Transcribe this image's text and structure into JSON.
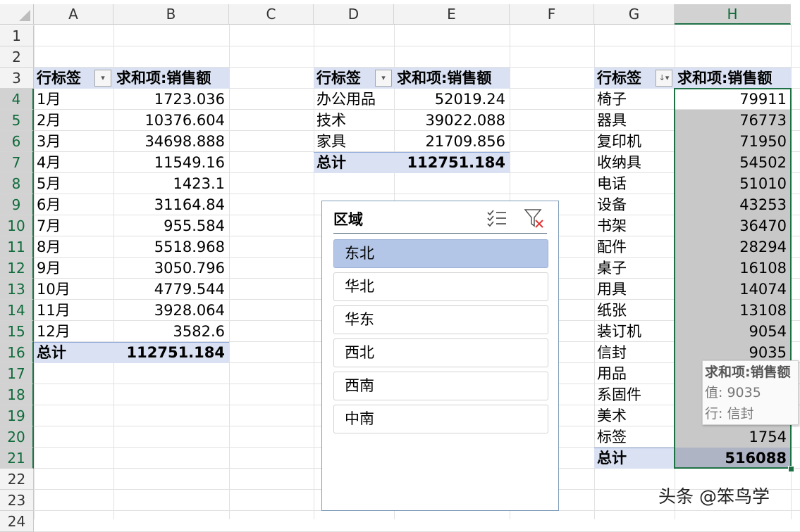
{
  "columns": [
    "A",
    "B",
    "C",
    "D",
    "E",
    "F",
    "G",
    "H"
  ],
  "rows": [
    "1",
    "2",
    "3",
    "4",
    "5",
    "6",
    "7",
    "8",
    "9",
    "10",
    "11",
    "12",
    "13",
    "14",
    "15",
    "16",
    "17",
    "18",
    "19",
    "20",
    "21",
    "22",
    "23",
    "24"
  ],
  "pivot_month": {
    "header_label": "行标签",
    "header_value": "求和项:销售额",
    "items": [
      {
        "label": "1月",
        "value": "1723.036"
      },
      {
        "label": "2月",
        "value": "10376.604"
      },
      {
        "label": "3月",
        "value": "34698.888"
      },
      {
        "label": "4月",
        "value": "11549.16"
      },
      {
        "label": "5月",
        "value": "1423.1"
      },
      {
        "label": "6月",
        "value": "31164.84"
      },
      {
        "label": "7月",
        "value": "955.584"
      },
      {
        "label": "8月",
        "value": "5518.968"
      },
      {
        "label": "9月",
        "value": "3050.796"
      },
      {
        "label": "10月",
        "value": "4779.544"
      },
      {
        "label": "11月",
        "value": "3928.064"
      },
      {
        "label": "12月",
        "value": "3582.6"
      }
    ],
    "total_label": "总计",
    "total_value": "112751.184"
  },
  "pivot_category": {
    "header_label": "行标签",
    "header_value": "求和项:销售额",
    "items": [
      {
        "label": "办公用品",
        "value": "52019.24"
      },
      {
        "label": "技术",
        "value": "39022.088"
      },
      {
        "label": "家具",
        "value": "21709.856"
      }
    ],
    "total_label": "总计",
    "total_value": "112751.184"
  },
  "pivot_subcategory": {
    "header_label": "行标签",
    "header_value": "求和项:销售额",
    "items": [
      {
        "label": "椅子",
        "value": "79911"
      },
      {
        "label": "器具",
        "value": "76773"
      },
      {
        "label": "复印机",
        "value": "71950"
      },
      {
        "label": "收纳具",
        "value": "54502"
      },
      {
        "label": "电话",
        "value": "51010"
      },
      {
        "label": "设备",
        "value": "43253"
      },
      {
        "label": "书架",
        "value": "36470"
      },
      {
        "label": "配件",
        "value": "28294"
      },
      {
        "label": "桌子",
        "value": "16108"
      },
      {
        "label": "用具",
        "value": "14074"
      },
      {
        "label": "纸张",
        "value": "13108"
      },
      {
        "label": "装订机",
        "value": "9054"
      },
      {
        "label": "信封",
        "value": "9035"
      },
      {
        "label": "用品",
        "value": ""
      },
      {
        "label": "系固件",
        "value": ""
      },
      {
        "label": "美术",
        "value": ""
      },
      {
        "label": "标签",
        "value": "1754"
      }
    ],
    "total_label": "总计",
    "total_value": "516088"
  },
  "slicer": {
    "title": "区域",
    "items": [
      "东北",
      "华北",
      "华东",
      "西北",
      "西南",
      "中南"
    ],
    "selected": "东北"
  },
  "tooltip": {
    "title": "求和项:销售额",
    "value_line": "值: 9035",
    "row_line": "行: 信封"
  },
  "watermark": "头条 @笨鸟学",
  "colors": {
    "pivot_header_bg": "#d9e1f2",
    "selection_green": "#1e7145",
    "slicer_selected": "#b4c6e7"
  }
}
